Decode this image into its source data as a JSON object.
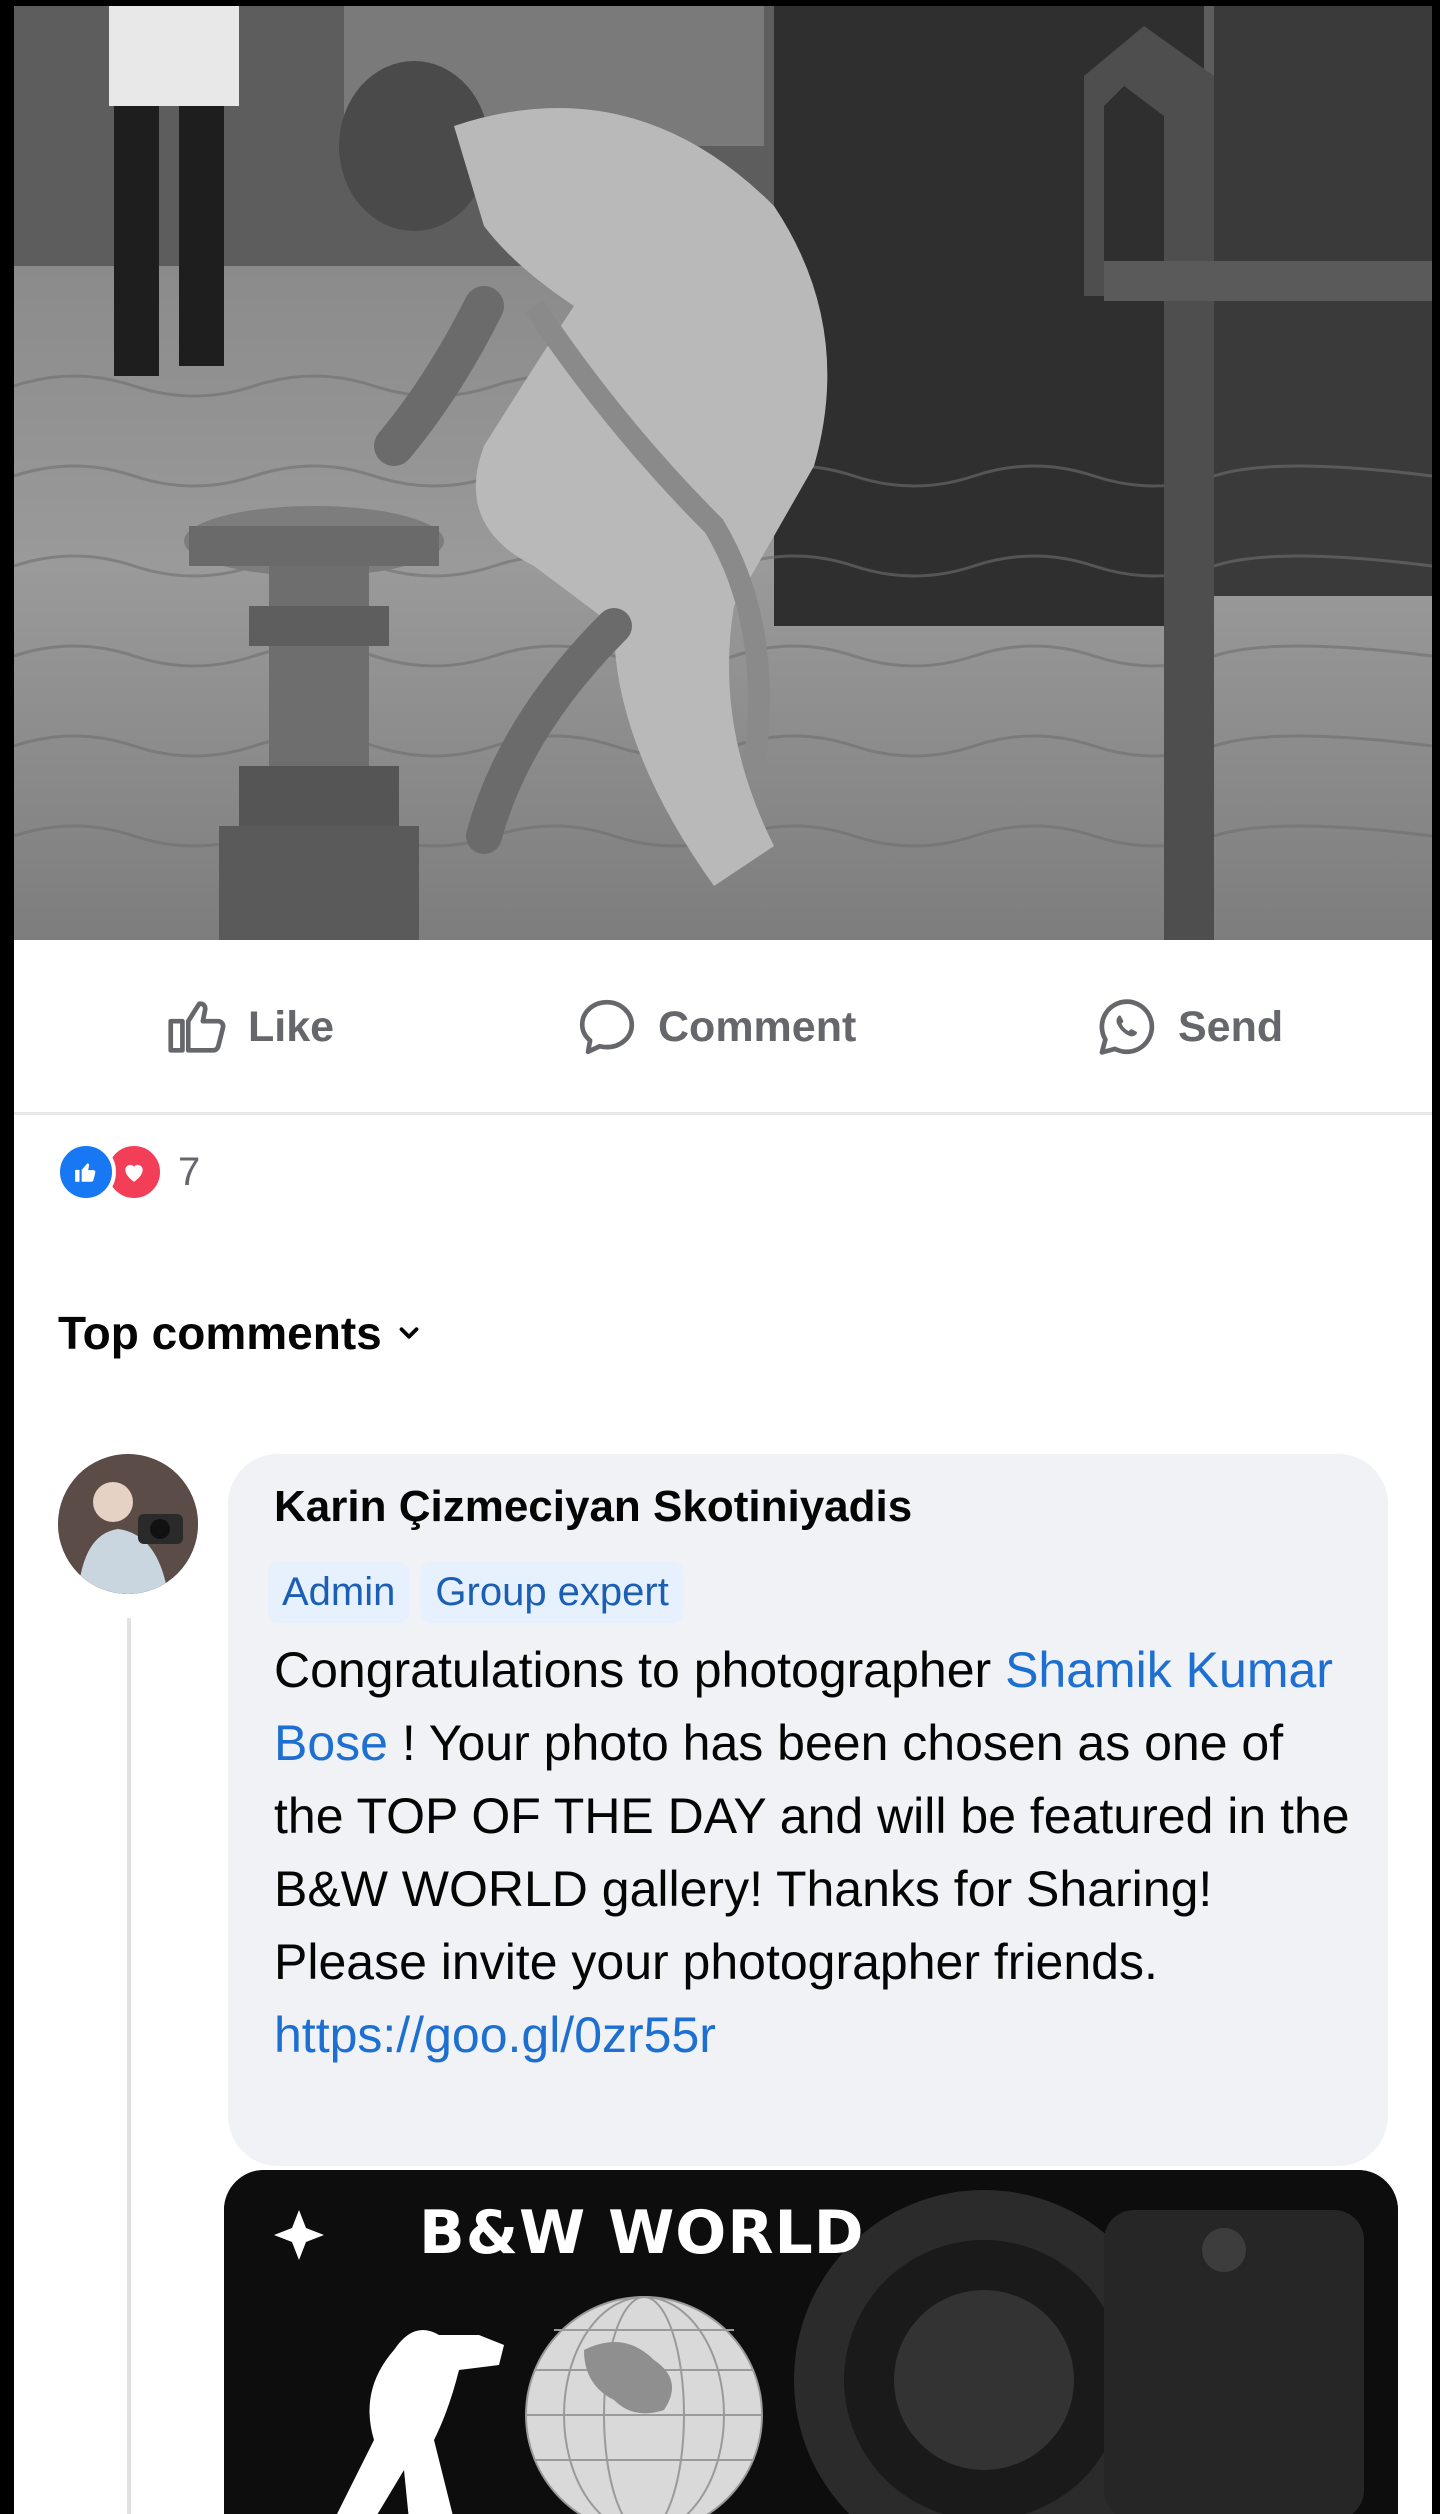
{
  "post": {
    "photo_icon": "post-photo",
    "actions": {
      "like_label": "Like",
      "comment_label": "Comment",
      "send_label": "Send"
    }
  },
  "reactions": {
    "icons": [
      "like-reaction-icon",
      "love-reaction-icon"
    ],
    "count": "7"
  },
  "comments_section": {
    "sort_label": "Top comments"
  },
  "comment": {
    "author": "Karin Çizmeciyan Skotiniyadis",
    "badges": [
      "Admin",
      "Group expert"
    ],
    "text_before": "Congratulations to photographer ",
    "mention": "Shamik Kumar Bose",
    "text_after": " ! Your photo has been chosen as one of the TOP OF THE DAY and will be featured in the B&W WORLD gallery! Thanks for Sharing! Please invite your photographer friends.",
    "link": "https://goo.gl/0zr55r",
    "attachment_title": "B&W WORLD"
  },
  "colors": {
    "link": "#1d6fd1",
    "action_text": "#65676b",
    "bubble": "#f0f2f5",
    "like_blue": "#1877f2",
    "love_red": "#f33e58"
  }
}
